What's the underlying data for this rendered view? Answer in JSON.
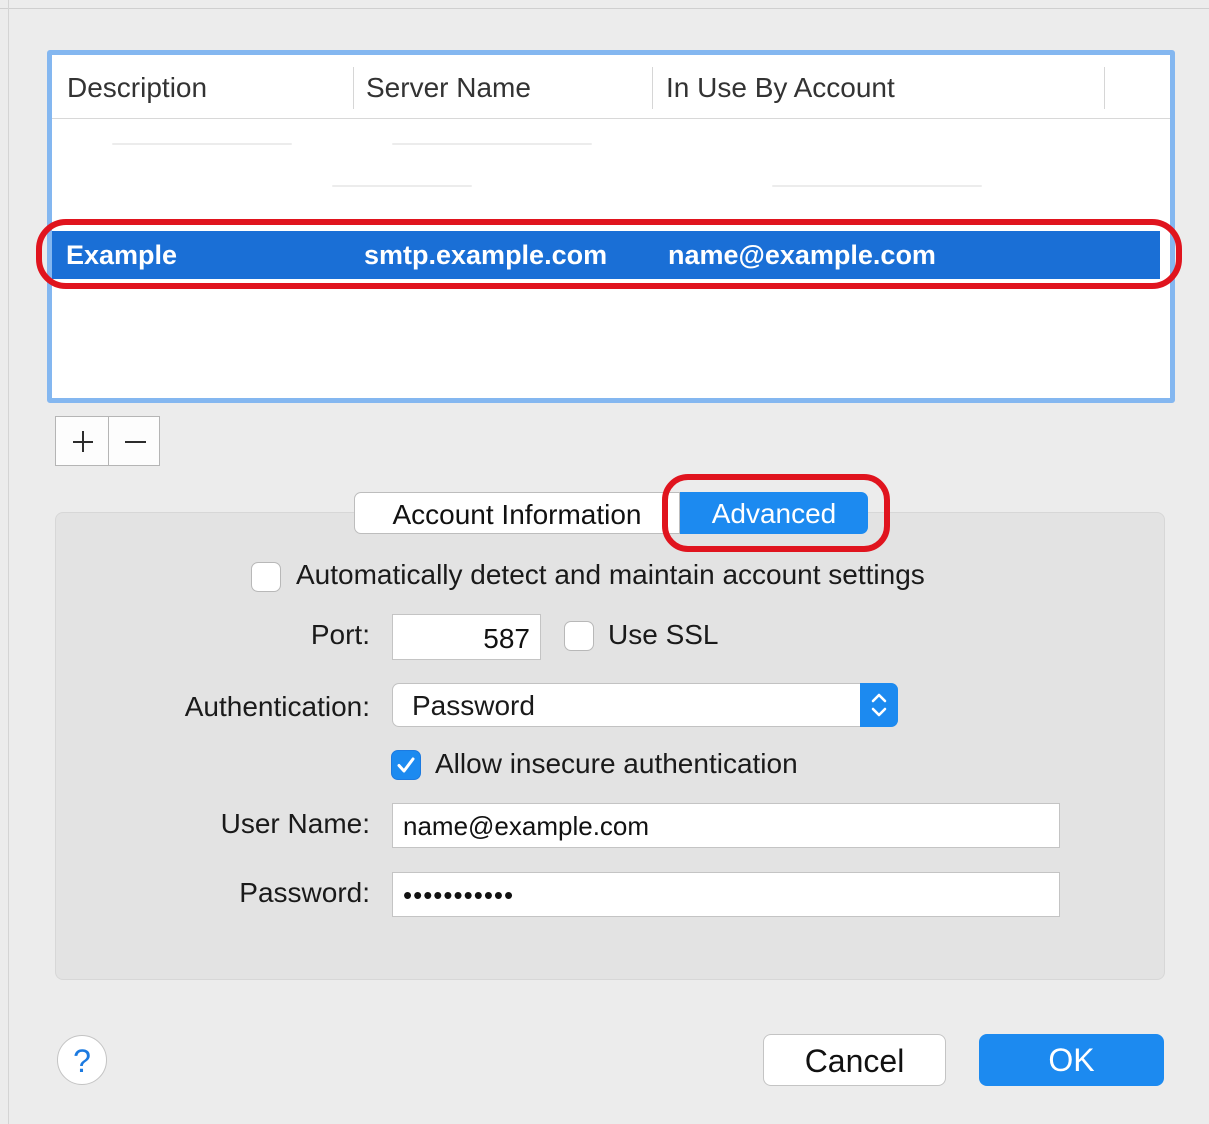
{
  "table": {
    "columns": [
      "Description",
      "Server Name",
      "In Use By Account"
    ],
    "selected_row": {
      "description": "Example",
      "server_name": "smtp.example.com",
      "account": "name@example.com"
    }
  },
  "list_controls": {
    "add_icon": "plus-icon",
    "remove_icon": "minus-icon"
  },
  "tabs": {
    "account_information": "Account Information",
    "advanced": "Advanced",
    "active": "Advanced"
  },
  "advanced": {
    "auto_detect_label": "Automatically detect and maintain account settings",
    "auto_detect_checked": false,
    "port_label": "Port:",
    "port_value": "587",
    "use_ssl_label": "Use SSL",
    "use_ssl_checked": false,
    "authentication_label": "Authentication:",
    "authentication_value": "Password",
    "allow_insecure_label": "Allow insecure authentication",
    "allow_insecure_checked": true,
    "username_label": "User Name:",
    "username_value": "name@example.com",
    "password_label": "Password:",
    "password_value": "•••••••••••"
  },
  "footer": {
    "help": "?",
    "cancel": "Cancel",
    "ok": "OK"
  },
  "colors": {
    "accent": "#1c8af0",
    "selection": "#1a6fd6",
    "highlight_ring": "#e0141e",
    "table_focus": "#84b7f0"
  }
}
